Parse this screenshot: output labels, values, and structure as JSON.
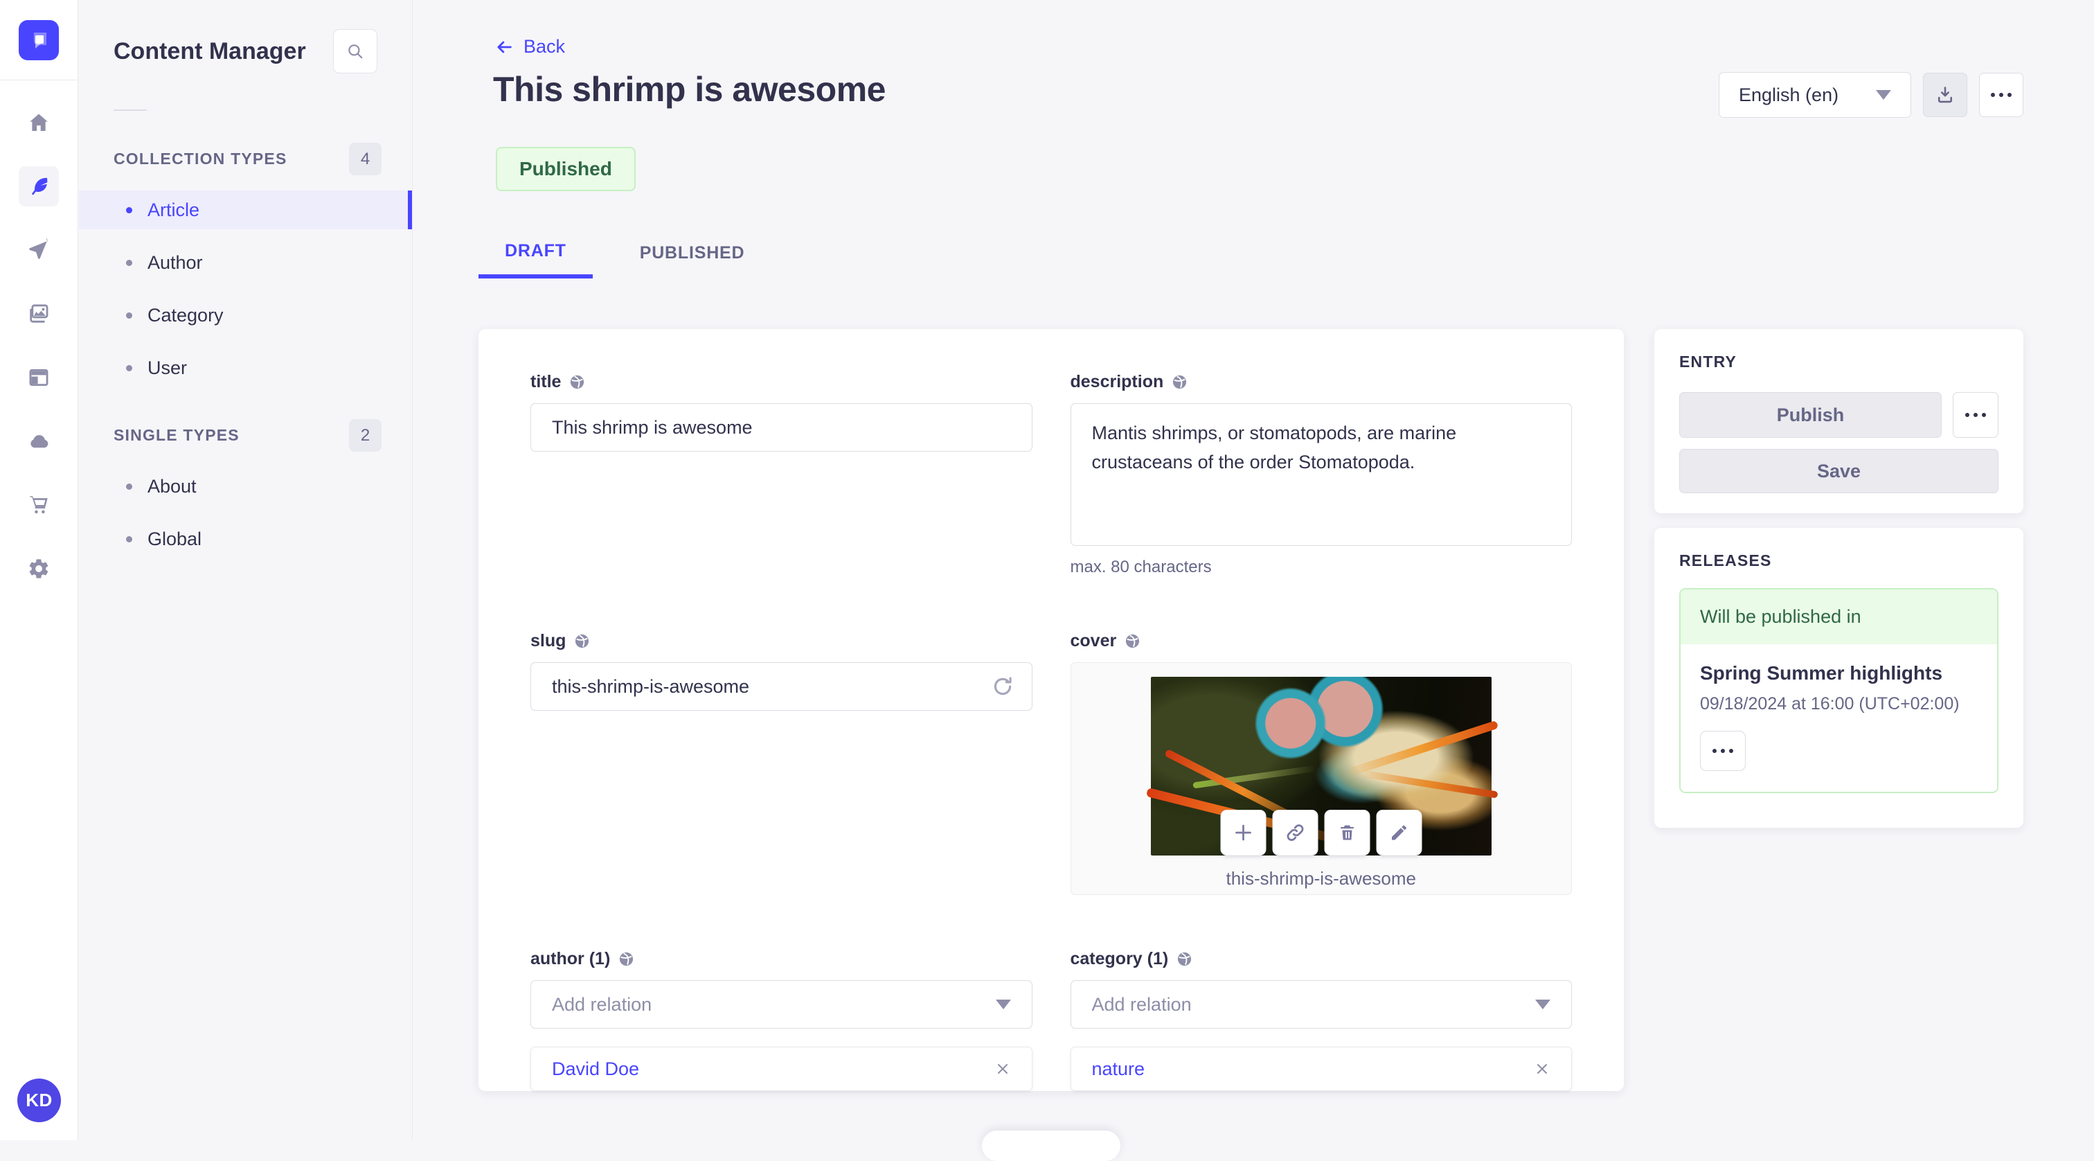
{
  "nav_rail": {
    "logo_icon": "strapi-logo",
    "icons": [
      "home-icon",
      "content-manager-feather-icon",
      "release-plane-icon",
      "media-library-icon",
      "content-type-builder-icon",
      "deploy-cloud-icon",
      "marketplace-cart-icon",
      "settings-gear-icon"
    ],
    "active_icon": "content-manager-feather-icon",
    "user_initials": "KD"
  },
  "subnav": {
    "title": "Content Manager",
    "search_icon": "search-icon",
    "sections": [
      {
        "label": "COLLECTION TYPES",
        "count": "4",
        "items": [
          {
            "label": "Article",
            "active": true
          },
          {
            "label": "Author",
            "active": false
          },
          {
            "label": "Category",
            "active": false
          },
          {
            "label": "User",
            "active": false
          }
        ]
      },
      {
        "label": "SINGLE TYPES",
        "count": "2",
        "items": [
          {
            "label": "About",
            "active": false
          },
          {
            "label": "Global",
            "active": false
          }
        ]
      }
    ]
  },
  "header": {
    "back_label": "Back",
    "title": "This shrimp is awesome",
    "status_badge": "Published",
    "locale_selected": "English (en)"
  },
  "tabs": [
    {
      "label": "DRAFT",
      "active": true
    },
    {
      "label": "PUBLISHED",
      "active": false
    }
  ],
  "form": {
    "title": {
      "label": "title",
      "value": "This shrimp is awesome"
    },
    "description": {
      "label": "description",
      "value": "Mantis shrimps, or stomatopods, are marine crustaceans of the order Stomatopoda.",
      "helper": "max. 80 characters"
    },
    "slug": {
      "label": "slug",
      "value": "this-shrimp-is-awesome"
    },
    "cover": {
      "label": "cover",
      "caption": "this-shrimp-is-awesome",
      "action_icons": [
        "add-asset-icon",
        "copy-link-icon",
        "delete-icon",
        "edit-icon"
      ]
    },
    "author": {
      "label": "author (1)",
      "placeholder": "Add relation",
      "relation": "David Doe"
    },
    "category": {
      "label": "category (1)",
      "placeholder": "Add relation",
      "relation": "nature"
    }
  },
  "entry_panel": {
    "heading": "ENTRY",
    "publish_label": "Publish",
    "save_label": "Save"
  },
  "releases_panel": {
    "heading": "RELEASES",
    "status": "Will be published in",
    "release_title": "Spring Summer highlights",
    "release_date": "09/18/2024 at 16:00 (UTC+02:00)"
  },
  "colors": {
    "primary": "#4945ff",
    "text_dark": "#32324d",
    "text_muted": "#666687",
    "success_text": "#2f6846",
    "success_bg": "#eafbe7",
    "success_border": "#c6f0c2",
    "border": "#dcdce4",
    "page_bg": "#f6f6f9"
  }
}
